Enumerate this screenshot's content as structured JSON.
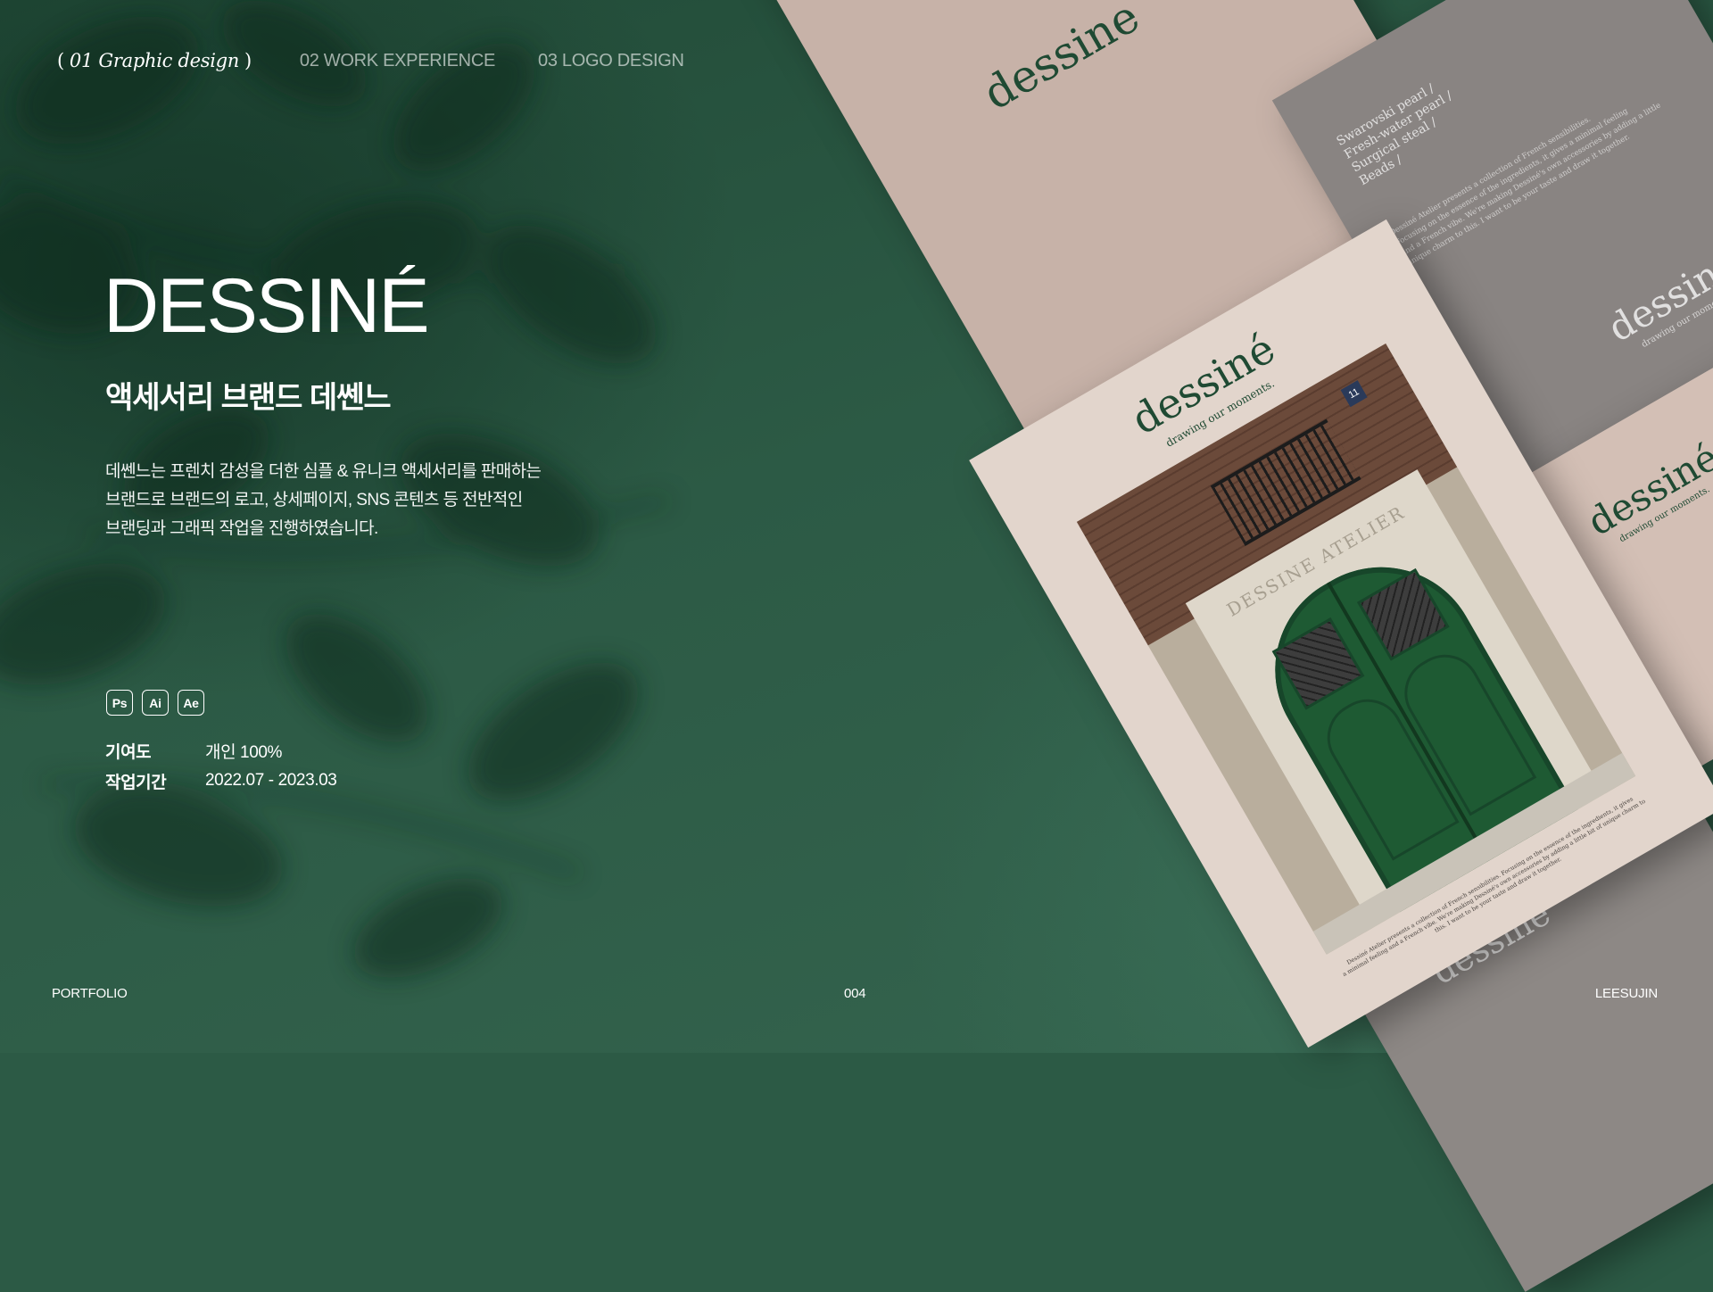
{
  "nav": {
    "active": "01 Graphic design",
    "paren_open": "(",
    "paren_close": ")",
    "items": [
      "02 WORK EXPERIENCE",
      "03 LOGO DESIGN"
    ]
  },
  "project": {
    "title": "DESSINÉ",
    "subtitle": "액세서리 브랜드 데쎈느",
    "description": [
      "데쎈느는 프렌치 감성을 더한 심플 & 유니크 액세서리를 판매하는",
      "브랜드로 브랜드의 로고, 상세페이지, SNS 콘텐츠 등 전반적인",
      "브랜딩과 그래픽 작업을 진행하였습니다."
    ],
    "tools": [
      "Ps",
      "Ai",
      "Ae"
    ],
    "meta": [
      {
        "label": "기여도",
        "value": "개인 100%"
      },
      {
        "label": "작업기간",
        "value": "2022.07 - 2023.03"
      }
    ]
  },
  "mockups": {
    "brand": "dessiné",
    "brand_plain": "dessine",
    "tagline": "drawing our moments.",
    "sign": "DESSINE ATELIER",
    "materials": [
      "Swarovski pearl /",
      "Fresh-water pearl /",
      "Surgical steal /",
      "Beads /"
    ],
    "blurb": [
      "Dessiné Atelier presents a collection of French sensibilities.",
      "Focusing on the essence of the ingredients, it gives a minimal feeling",
      "and a French vibe. We're making Dessiné's own accessories by adding a little",
      "unique charm to this. I want to be your taste and draw it together."
    ],
    "poster_caption": [
      "Dessiné Atelier presents a collection of French sensibilities. Focusing on the essence of the ingredients, it gives",
      "a minimal feeling and a French vibe. We're making Dessiné's own accessories by adding a little bit of unique charm to",
      "this. I want to be your taste and draw it together."
    ],
    "door_number": "11"
  },
  "footer": {
    "left": "PORTFOLIO",
    "center": "004",
    "right": "LEESUJIN"
  },
  "colors": {
    "background": "#2c5a45",
    "paper_beige": "#c9b3a9",
    "paper_gray": "#8a8582",
    "poster_cream": "#e3d6cd",
    "brand_green": "#1f4a33"
  }
}
